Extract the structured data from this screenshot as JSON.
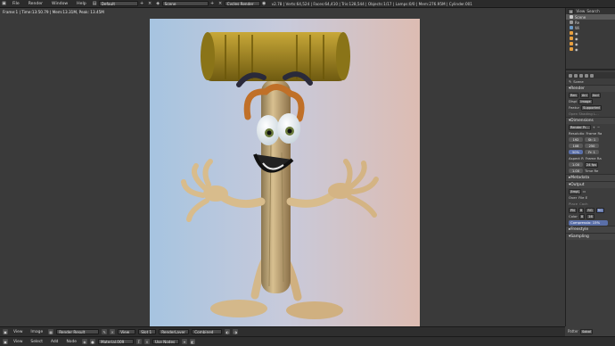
{
  "topbar": {
    "menus": [
      "File",
      "Render",
      "Window",
      "Help"
    ],
    "layout": "Default",
    "scene": "Scene",
    "engine": "Cycles Render",
    "stats": "v2.78 | Verts:64,524 | Faces:64,410 | Tris:128,544 | Objects:1/17 | Lamps:0/0 | Mem:276.95M | Cylinder.001"
  },
  "viewport": {
    "frame_info": "Frame:1 | Time:13:50.79 | Mem:13.31M, Peak: 13.45M"
  },
  "outliner": {
    "view_label": "View",
    "search_label": "Search",
    "rows": [
      "Scene",
      "Re",
      "Wi",
      "",
      "",
      "",
      ""
    ]
  },
  "properties": {
    "scene_label": "Scene",
    "render_section": "Render",
    "render_buttons": [
      "Ren",
      "Ani",
      "Aud"
    ],
    "display_label": "Displ",
    "display_value": "Image",
    "feature_label": "Featur",
    "feature_value": "Supported",
    "open_shading": "Open Shading L...",
    "dimensions_section": "Dimensions",
    "render_presets": "Render Pr...",
    "resolution_label": "Resolutio",
    "frame_range_label": "Frame Ra",
    "res_x": "192",
    "res_y": "108",
    "res_pct": "50%",
    "frame_start": "St: 1",
    "frame_end": "250",
    "frame_step": "Fr: 1",
    "aspect_label": "Aspect R",
    "frame_rate_label": "Frame Ra",
    "aspect_x": "1.00",
    "aspect_y": "1.00",
    "fps": "24 fps",
    "time_rem_label": "Time Re",
    "metadata_section": "Metadata",
    "output_section": "Output",
    "output_path": "/tmp\\",
    "overwrite": "Over",
    "file_ext": "File E",
    "placeholders": "Place",
    "cache": "Cach",
    "format": "PN",
    "bw": "B",
    "rgb": "RG",
    "rgba": "RG",
    "color_label": "Color",
    "color_depth": "8",
    "color_depth2": "16",
    "compression": "Compressio: 15%",
    "freestyle_section": "Freestyle",
    "sampling_section": "Sampling",
    "sampling_preset": "Sampling ...",
    "path_label": "Path",
    "square_label": "Squar",
    "settings_label": "Settings",
    "samples_label": "Samples:",
    "seed": "0",
    "render_samples": "500",
    "clamp1": "0.00",
    "preview_samples": "32",
    "clamp2": "0.00",
    "pattern_label": "Patter",
    "pattern_value": "Sobol",
    "geometry_section": "Geometry"
  },
  "image_editor_bar": {
    "menus": [
      "View",
      "Image"
    ],
    "image_name": "Render Result",
    "view_label": "View",
    "slot": "Slot 1",
    "layer": "RenderLayer",
    "pass": "Combined"
  },
  "node_editor_bar": {
    "menus": [
      "View",
      "Select",
      "Add",
      "Node"
    ],
    "material": "Material.009",
    "use_nodes": "Use Nodes"
  },
  "colors": {
    "background_left": "#9ec0df",
    "background_right": "#d8b8b0",
    "handle": "#b8a070",
    "hammer_head": "#a08622",
    "hair": "#c07028"
  }
}
